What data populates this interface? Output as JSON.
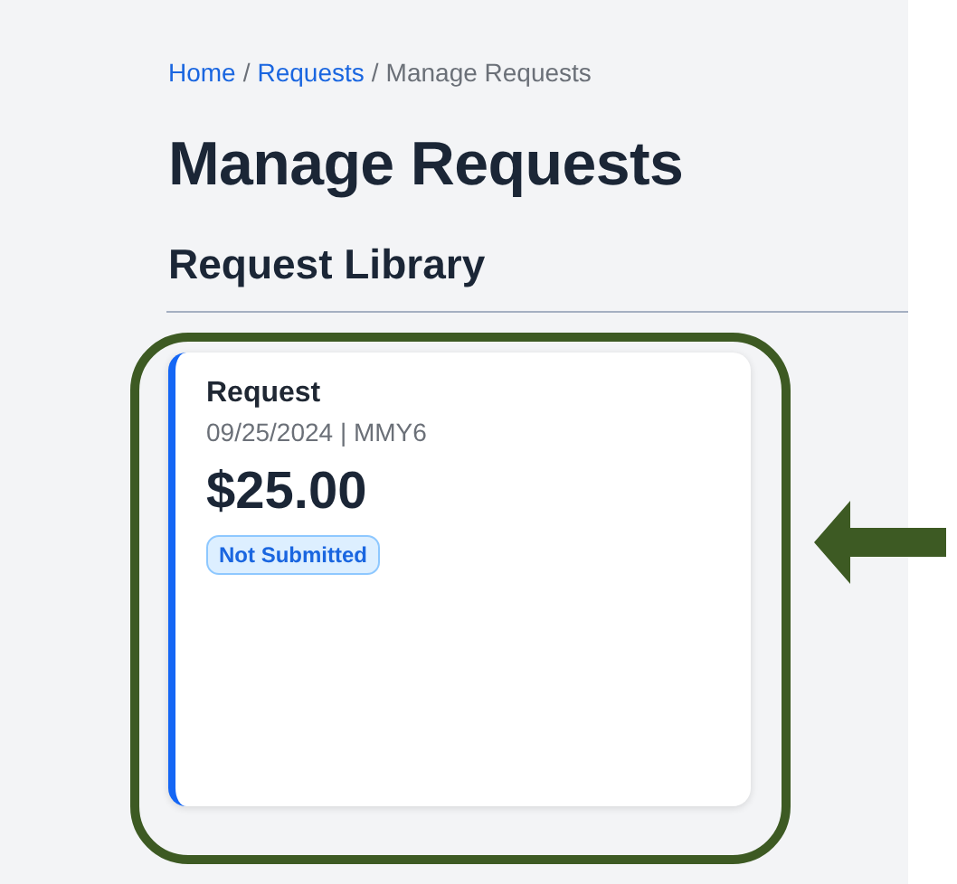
{
  "breadcrumb": [
    {
      "label": "Home",
      "kind": "link"
    },
    {
      "label": "/",
      "kind": "separator"
    },
    {
      "label": "Requests",
      "kind": "link"
    },
    {
      "label": "/",
      "kind": "separator"
    },
    {
      "label": "Manage Requests",
      "kind": "current"
    }
  ],
  "title": "Manage Requests",
  "section_title": "Request Library",
  "cards": [
    {
      "title": "Request",
      "meta": "09/25/2024 | MMY6",
      "amount": "$25.00",
      "status": "Not Submitted"
    }
  ]
}
